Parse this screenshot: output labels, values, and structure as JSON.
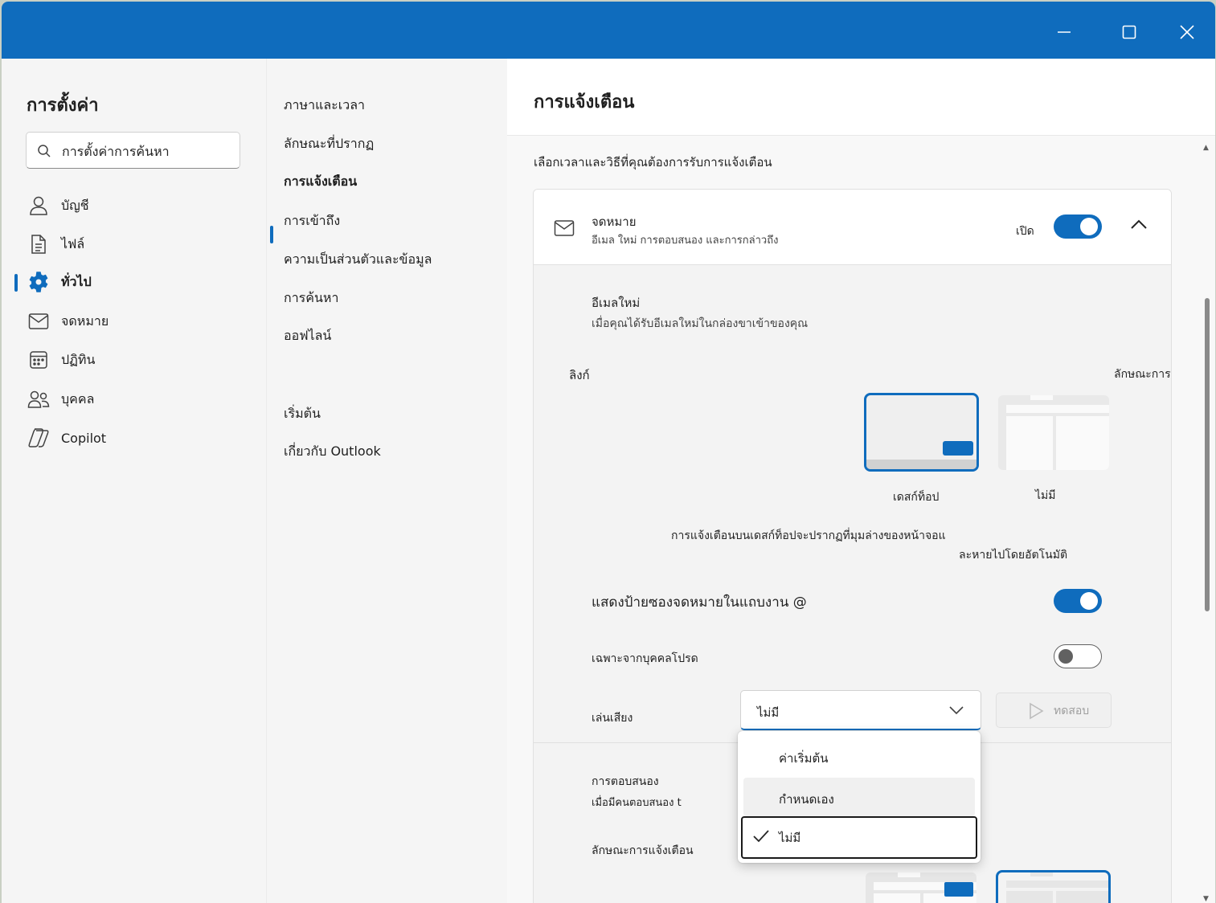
{
  "window": {
    "controls": {
      "minimize": "minimize",
      "maximize": "maximize",
      "close": "close"
    }
  },
  "sidebar": {
    "title": "การตั้งค่า",
    "search": {
      "placeholder": "การตั้งค่าการค้นหา",
      "value": ""
    },
    "items": [
      {
        "label": "บัญชี",
        "icon": "person-icon"
      },
      {
        "label": "ไฟล์",
        "icon": "document-icon"
      },
      {
        "label": "ทั่วไป",
        "icon": "gear-icon",
        "active": true
      },
      {
        "label": "จดหมาย",
        "icon": "mail-icon"
      },
      {
        "label": "ปฏิทิน",
        "icon": "calendar-icon"
      },
      {
        "label": "บุคคล",
        "icon": "people-icon"
      },
      {
        "label": "Copilot",
        "icon": "copilot-icon"
      }
    ]
  },
  "subnav": {
    "items": [
      {
        "label": "ภาษาและเวลา"
      },
      {
        "label": "ลักษณะที่ปรากฏ"
      },
      {
        "label": "การแจ้งเตือน",
        "active": true
      },
      {
        "label": "การเข้าถึง"
      },
      {
        "label": "ความเป็นส่วนตัวและข้อมูล"
      },
      {
        "label": "การค้นหา"
      },
      {
        "label": "ออฟไลน์"
      },
      {
        "label": "เริ่มต้น"
      },
      {
        "label": "เกี่ยวกับ Outlook"
      }
    ]
  },
  "main": {
    "title": "การแจ้งเตือน",
    "subtitle": "เลือกเวลาและวิธีที่คุณต้องการรับการแจ้งเตือน",
    "mail_card": {
      "title": "จดหมาย",
      "description": "อีเมล ใหม่ การตอบสนอง และการกล่าวถึง",
      "state_label": "เปิด",
      "enabled": true,
      "new_email": {
        "title": "อีเมลใหม่",
        "description": "เมื่อคุณได้รับอีเมลใหม่ในกล่องขาเข้าของคุณ"
      },
      "link_label": "ลิงก์",
      "style_label": "ลักษณะการแจ้งเตือน",
      "style_options": [
        {
          "label": "เดสก์ท็อป",
          "selected": true
        },
        {
          "label": "ไม่มี",
          "selected": false
        }
      ],
      "desktop_note_1": "การแจ้งเตือนบนเดสก์ท็อปจะปรากฏที่มุมล่างของหน้าจอแ",
      "desktop_note_2": "ละหายไปโดยอัตโนมัติ",
      "show_badge": {
        "label": "แสดงป้ายซองจดหมายในแถบงาน @",
        "on": true
      },
      "favorites_only": {
        "label": "เฉพาะจากบุคคลโปรด",
        "on": false
      },
      "play_sound": {
        "label": "เล่นเสียง",
        "value": "ไม่มี"
      },
      "test_button": "ทดสอบ",
      "reactions": {
        "title": "การตอบสนอง",
        "description": "เมื่อมีคนตอบสนอง t",
        "style_label": "ลักษณะการแจ้งเตือน"
      }
    },
    "sound_dropdown": {
      "options": [
        "ค่าเริ่มต้น",
        "กำหนดเอง",
        "ไม่มี"
      ],
      "selected": "ไม่มี",
      "hovered": "กำหนดเอง"
    }
  },
  "colors": {
    "accent": "#0f6cbd",
    "titlebar": "#0f6cbd"
  }
}
